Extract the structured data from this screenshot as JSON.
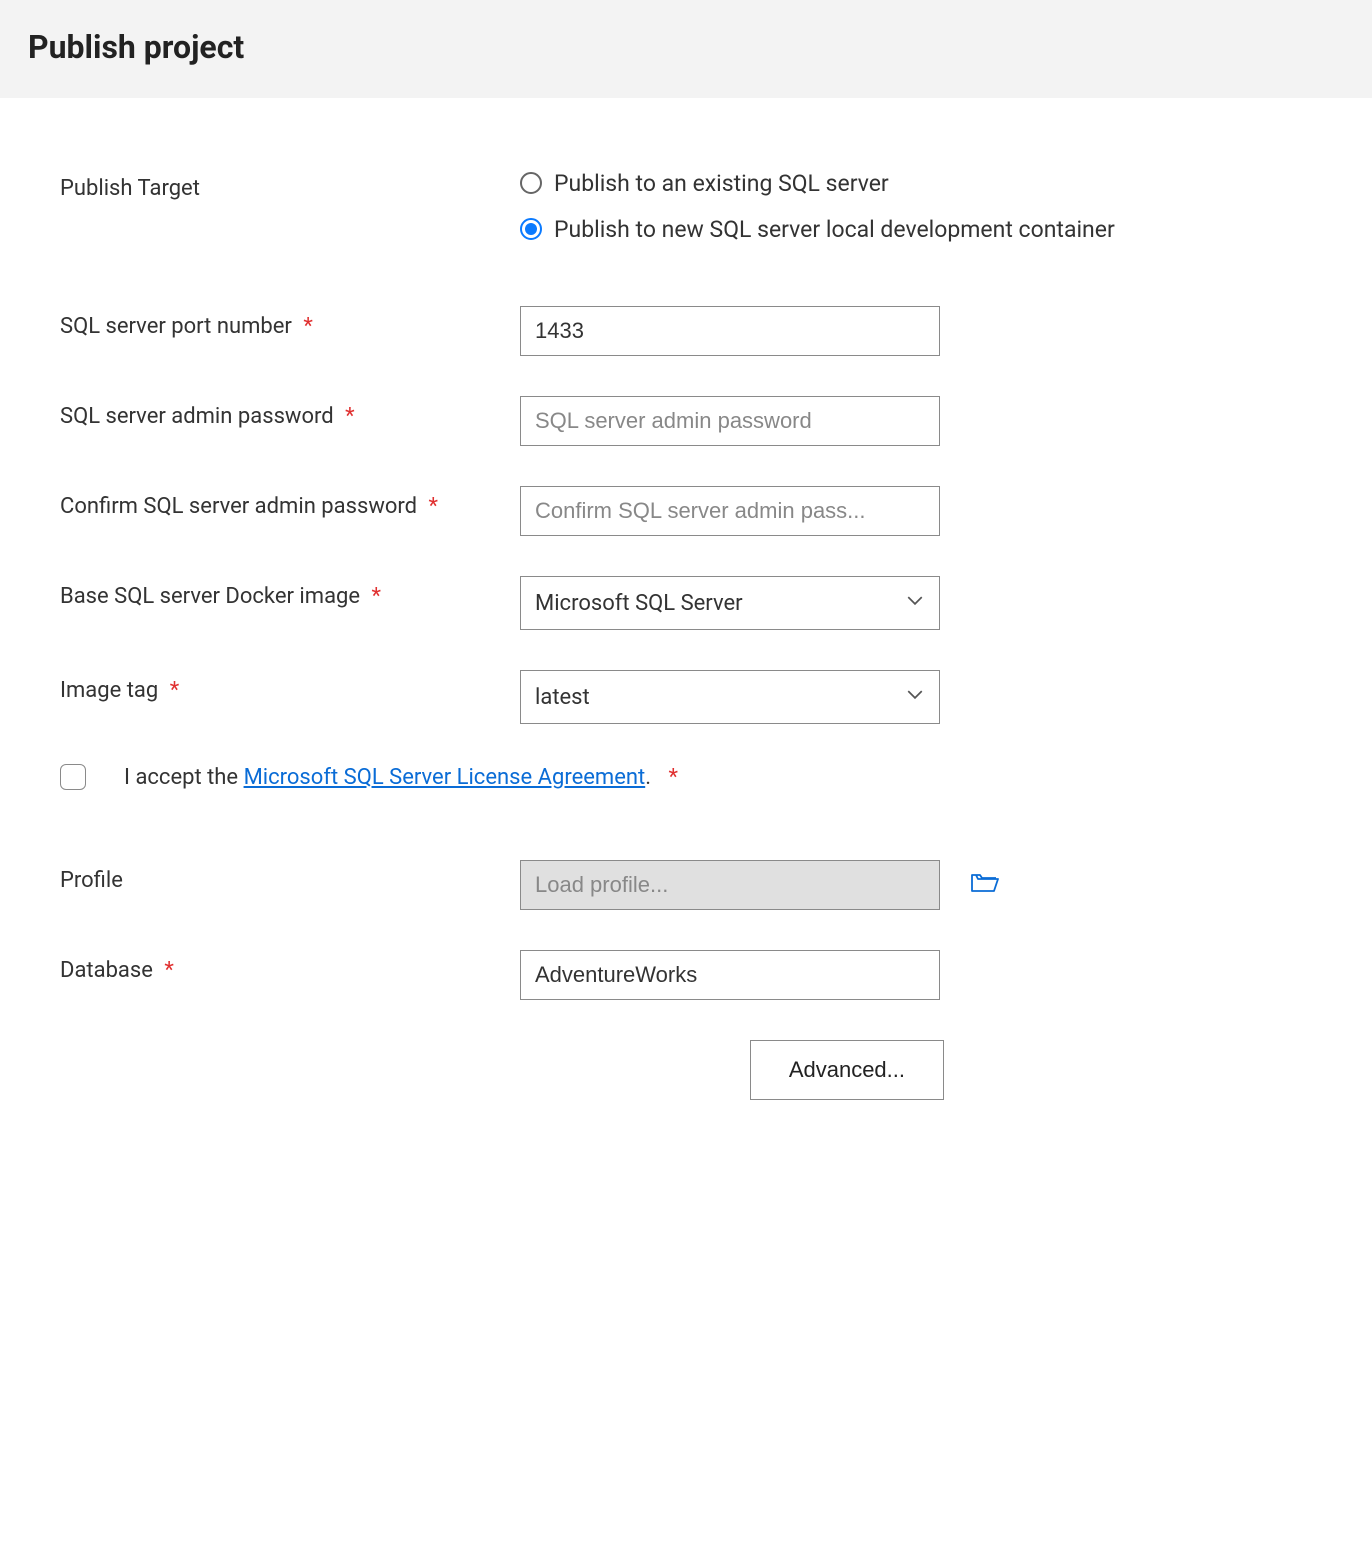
{
  "header": {
    "title": "Publish project"
  },
  "form": {
    "publishTarget": {
      "label": "Publish Target",
      "options": [
        {
          "label": "Publish to an existing SQL server"
        },
        {
          "label": "Publish to new SQL server local development container"
        }
      ]
    },
    "port": {
      "label": "SQL server port number",
      "value": "1433"
    },
    "password": {
      "label": "SQL server admin password",
      "placeholder": "SQL server admin password"
    },
    "confirmPassword": {
      "label": "Confirm SQL server admin password",
      "placeholder": "Confirm SQL server admin pass..."
    },
    "dockerImage": {
      "label": "Base SQL server Docker image",
      "value": "Microsoft SQL Server"
    },
    "imageTag": {
      "label": "Image tag",
      "value": "latest"
    },
    "accept": {
      "prefix": "I accept the ",
      "linkText": "Microsoft SQL Server License Agreement",
      "suffix": "."
    },
    "profile": {
      "label": "Profile",
      "placeholder": "Load profile..."
    },
    "database": {
      "label": "Database",
      "value": "AdventureWorks"
    },
    "advancedButton": "Advanced..."
  }
}
